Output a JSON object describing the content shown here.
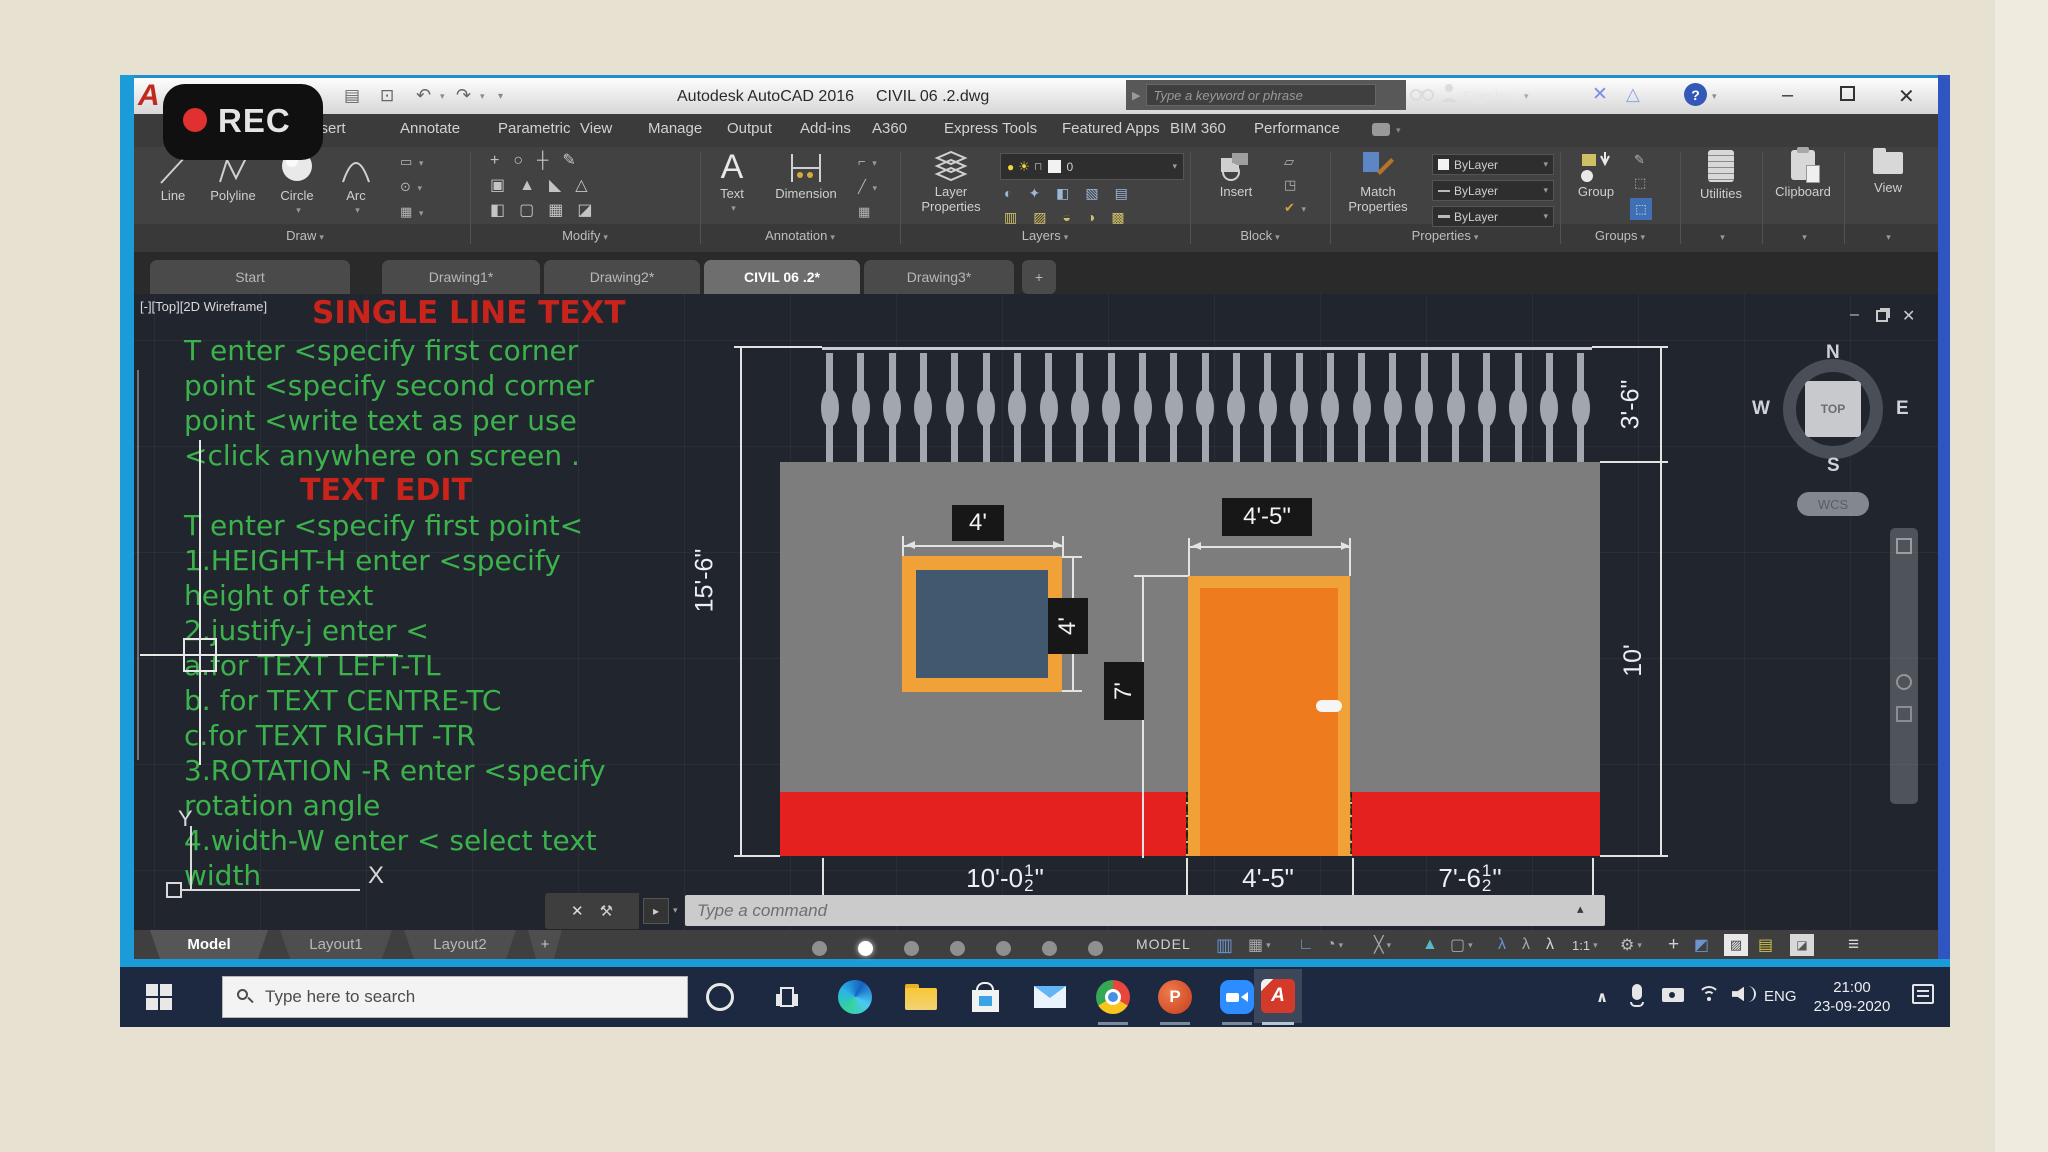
{
  "rec_label": "REC",
  "titlebar": {
    "app": "Autodesk AutoCAD 2016",
    "doc": "CIVIL 06 .2.dwg",
    "search_placeholder": "Type a keyword or phrase",
    "sign_in": "Sign In"
  },
  "menu": {
    "items": [
      "Insert",
      "Annotate",
      "Parametric",
      "View",
      "Manage",
      "Output",
      "Add-ins",
      "A360",
      "Express Tools",
      "Featured Apps",
      "BIM 360",
      "Performance"
    ]
  },
  "ribbon": {
    "draw": {
      "label": "Draw",
      "line": "Line",
      "polyline": "Polyline",
      "circle": "Circle",
      "arc": "Arc"
    },
    "modify": {
      "label": "Modify"
    },
    "annotation": {
      "label": "Annotation",
      "text": "Text",
      "dimension": "Dimension"
    },
    "layers": {
      "label": "Layers",
      "layer_properties": "Layer Properties",
      "current_layer": "0"
    },
    "block": {
      "label": "Block",
      "insert": "Insert"
    },
    "properties": {
      "label": "Properties",
      "match_properties": "Match Properties",
      "bylayer1": "ByLayer",
      "bylayer2": "ByLayer",
      "bylayer3": "ByLayer"
    },
    "groups": {
      "label": "Groups",
      "group": "Group"
    },
    "utilities": {
      "label": "Utilities"
    },
    "clipboard": {
      "label": "Clipboard"
    },
    "view": {
      "label": "View"
    }
  },
  "file_tabs": {
    "start": "Start",
    "d1": "Drawing1*",
    "d2": "Drawing2*",
    "civil": "CIVIL 06 .2*",
    "d3": "Drawing3*",
    "add": "+"
  },
  "canvas": {
    "viewport_label": "[-][Top][2D Wireframe]",
    "lesson_title_1": "SINGLE LINE TEXT",
    "lesson_lines_1": [
      "T enter <specify first corner",
      "point <specify second corner",
      "point <write text as per use",
      "<click anywhere on screen ."
    ],
    "lesson_title_2": "TEXT EDIT",
    "lesson_lines_2": [
      "T enter <specify first point<",
      "1.HEIGHT-H enter <specify",
      "height of text",
      "2.justify-j enter <",
      "a.for TEXT LEFT-TL",
      "b. for TEXT CENTRE-TC",
      "c.for TEXT RIGHT -TR",
      "3.ROTATION -R enter <specify",
      "rotation angle",
      "4.width-W enter < select text",
      "width"
    ],
    "ucs": {
      "x": "X",
      "y": "Y"
    }
  },
  "elevation": {
    "dim_window_width": "4'",
    "dim_window_height": "4'",
    "dim_door_width": "4'-5\"",
    "dim_door_height": "7'",
    "dim_fence_height": "3'-6\"",
    "dim_left_height": "15'-6\"",
    "dim_right_height": "10'",
    "bottom_dims": [
      {
        "whole": "10'-0",
        "num": "1",
        "den": "2",
        "suffix": "\""
      },
      {
        "whole": "4'-5\"",
        "num": "",
        "den": "",
        "suffix": ""
      },
      {
        "whole": "7'-6",
        "num": "1",
        "den": "2",
        "suffix": "\""
      }
    ],
    "colors": {
      "wall": "#7d7d7d",
      "plinth": "#e4211f",
      "frame": "#f0a238",
      "door": "#ee7c1f",
      "glass": "#41586e"
    }
  },
  "viewcube": {
    "n": "N",
    "e": "E",
    "s": "S",
    "w": "W",
    "top": "TOP",
    "wcs": "WCS"
  },
  "command": {
    "placeholder": "Type a command"
  },
  "bottombar": {
    "tabs": [
      "Model",
      "Layout1",
      "Layout2"
    ],
    "add_tab": "+",
    "model_space": "MODEL",
    "scale": "1:1"
  },
  "taskbar": {
    "search_placeholder": "Type here to search",
    "lang": "ENG",
    "time": "21:00",
    "date": "23-09-2020"
  }
}
